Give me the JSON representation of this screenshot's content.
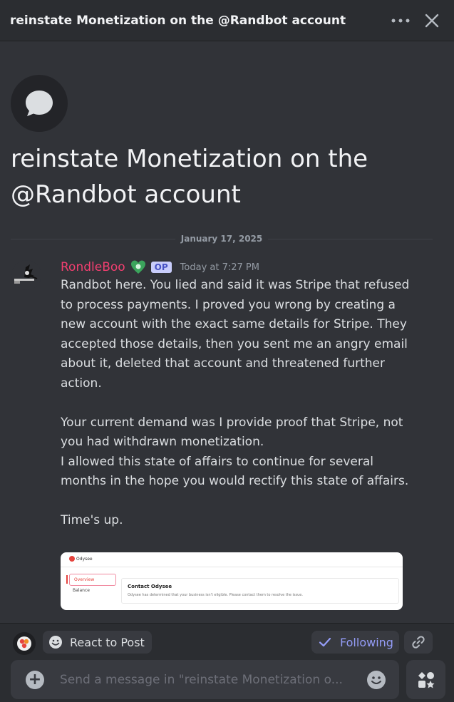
{
  "header": {
    "title": "reinstate Monetization on the @Randbot account",
    "more_icon": "more-dots-icon",
    "close_icon": "close-icon"
  },
  "thread": {
    "icon": "chat-bubble-icon",
    "title": "reinstate Monetization on the @Randbot account"
  },
  "date_divider": "January 17, 2025",
  "message": {
    "author": "RondleBoo",
    "author_color": "#f23f70",
    "role_icon": "role-icon",
    "op_badge": "OP",
    "timestamp": "Today at 7:27 PM",
    "body": "Randbot here. You lied and said it was Stripe that refused to process payments. I proved you wrong by creating a new account with the exact same details for Stripe. They accepted those details, then you sent me an angry email about it, deleted that account and threatened further action.\n\nYour current demand was I provide proof that Stripe, not you had withdrawn monetization.\nI allowed this state of affairs to continue for several months in the hope you would rectify this state of affairs.\n\nTime's up.",
    "attachment": {
      "brand": "Odysee",
      "sidebar_active": "Overview",
      "sidebar_item": "Balance",
      "card_title": "Contact Odysee",
      "card_text": "Odysee has determined that your business isn't eligible. Please contact them to resolve the issue."
    }
  },
  "actions": {
    "react_label": "React to Post",
    "follow_label": "Following",
    "link_icon": "link-icon",
    "accent": "#949cf7"
  },
  "composer": {
    "placeholder": "Send a message in \"reinstate Monetization o...",
    "plus_icon": "plus-circle-icon",
    "emoji_icon": "emoji-icon",
    "apps_icon": "apps-icon"
  }
}
